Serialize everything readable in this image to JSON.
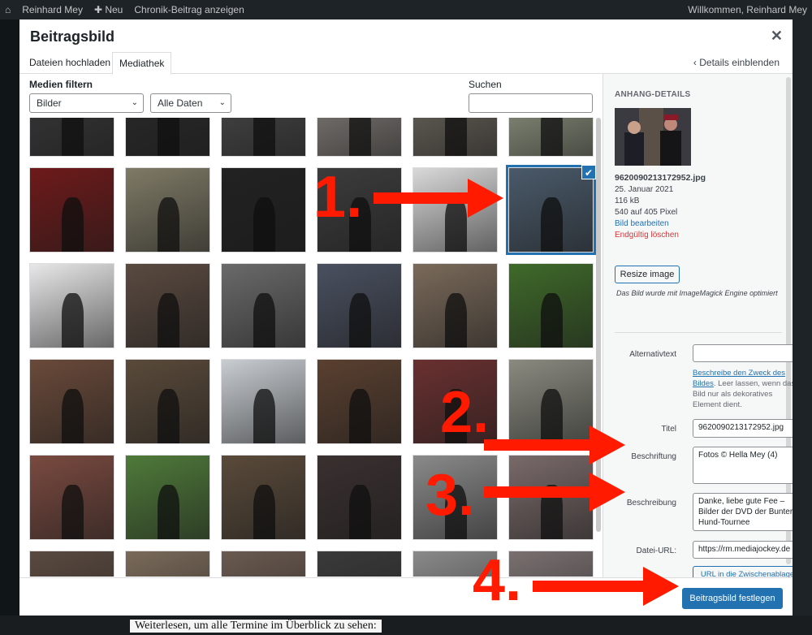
{
  "admin_bar": {
    "site_name": "Reinhard Mey",
    "new_label": "Neu",
    "view_post": "Chronik-Beitrag anzeigen",
    "welcome": "Willkommen, Reinhard Mey"
  },
  "background_text": "Weiterlesen, um alle Termine im Überblick zu sehen:",
  "modal": {
    "title": "Beitragsbild",
    "close_icon": "close-icon",
    "tabs": [
      "Dateien hochladen",
      "Mediathek"
    ],
    "active_tab": "Mediathek",
    "details_toggle": "Details einblenden"
  },
  "filters": {
    "label": "Medien filtern",
    "type_select": "Bilder",
    "date_select": "Alle Daten",
    "search_label": "Suchen",
    "search_value": ""
  },
  "grid": {
    "selected_index": 11,
    "tile_colors": [
      "#3a3a3a",
      "#2b2b2b",
      "#4a4a4a",
      "#8a8580",
      "#6f6a60",
      "#9aa08a",
      "#6e1a1a",
      "#7f7a66",
      "#222222",
      "#3c3c3c",
      "#d9d9d9",
      "#4a5a6a",
      "#e8e8e8",
      "#5a4a40",
      "#6a6a6a",
      "#4a5060",
      "#7a6a5a",
      "#3f6a2a",
      "#6a4a3a",
      "#5a4a3a",
      "#c8cdd2",
      "#5a4030",
      "#6a3030",
      "#8a8a80",
      "#7a4a40",
      "#4f7a3a",
      "#5a4a3a",
      "#3a3030",
      "#8a8a8a",
      "#7a6a6a",
      "#5a4a40",
      "#7a6a5a",
      "#6a5a50",
      "#3a3a3a",
      "#8a8a8a",
      "#7a7070"
    ]
  },
  "details": {
    "heading": "ANHANG-DETAILS",
    "filename": "9620090213172952.jpg",
    "date": "25. Januar 2021",
    "size": "116 kB",
    "dimensions": "540 auf 405 Pixel",
    "edit_link": "Bild bearbeiten",
    "delete_link": "Endgültig löschen",
    "resize_button": "Resize image",
    "note": "Das Bild wurde mit ImageMagick Engine optimiert",
    "alt_label": "Alternativtext",
    "alt_value": "",
    "alt_help_link": "Beschreibe den Zweck des Bildes",
    "alt_help_rest": ". Leer lassen, wenn das Bild nur als dekoratives Element dient.",
    "title_label": "Titel",
    "title_value": "9620090213172952.jpg",
    "caption_label": "Beschriftung",
    "caption_value": "Fotos © Hella Mey (4)",
    "description_label": "Beschreibung",
    "description_value": "Danke, liebe gute Fee – Bilder der DVD der Bunter-Hund-Tournee",
    "url_label": "Datei-URL:",
    "url_value": "https://rm.mediajockey.de",
    "copy_button": "URL in die Zwischenablage kopieren"
  },
  "footer": {
    "primary_button": "Beitragsbild festlegen"
  },
  "annotations": [
    "1.",
    "2.",
    "3.",
    "4."
  ]
}
